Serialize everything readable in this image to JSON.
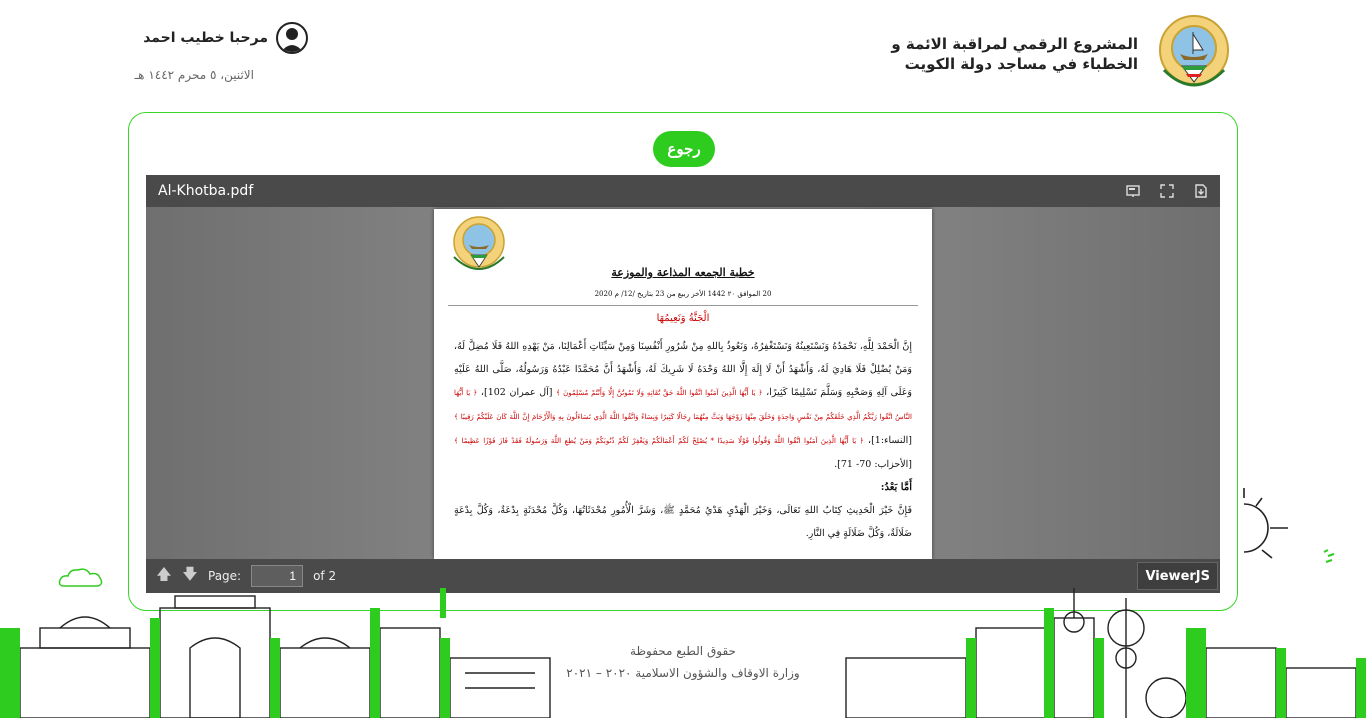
{
  "header": {
    "site_title_line1": "المشروع الرقمي لمراقبة الائمة و",
    "site_title_line2": "الخطباء في مساجد دولة الكويت",
    "greeting": "مرحبا خطيب احمد",
    "date": "الاثنين، ٥ محرم ١٤٤٢ هـ"
  },
  "main": {
    "back_label": "رجوع"
  },
  "viewer": {
    "file_name": "Al-Khotba.pdf",
    "page_label": "Page:",
    "page_value": "1",
    "page_total": "of 2",
    "brand": "ViewerJS",
    "icons": [
      "presentation-icon",
      "fullscreen-icon",
      "download-icon",
      "arrow-up-icon",
      "arrow-down-icon"
    ]
  },
  "pdf": {
    "title": "خطبة الجمعه المذاعة والموزعة",
    "subtitle": "20 الموافق ٢٠ 1442 الأخر ربيع من 23 بتاريخ /12/ م 2020",
    "heading": "الْجَنَّةُ وَنَعِيمُهَا",
    "p1": "إِنَّ الْحَمْدَ لِلَّهِ، نَحْمَدُهُ وَنَسْتَعِينُهُ وَنَسْتَغْفِرُهُ، وَنَعُوذُ بِاللهِ مِنْ شُرُورِ أَنْفُسِنَا وَمِنْ سَيِّئَاتِ أَعْمَالِنَا، مَنْ يَهْدِهِ اللهُ فَلَا مُضِلَّ لَهُ، وَمَنْ يُضْلِلْ فَلَا هَادِيَ لَهُ، وَأَشْهَدُ أَنْ لَا إِلَهَ إِلَّا اللهُ وَحْدَهُ لَا شَرِيكَ لَهُ، وَأَشْهَدُ أَنَّ مُحَمَّدًا عَبْدُهُ وَرَسُولُهُ، صَلَّى اللهُ عَلَيْهِ وَعَلَى آلِهِ وَصَحْبِهِ وَسَلَّمَ تَسْلِيمًا كَثِيرًا،",
    "q1": "﴿ يَا أَيُّهَا الَّذِينَ آمَنُوا اتَّقُوا اللَّهَ حَقَّ تُقَاتِهِ وَلَا تَمُوتُنَّ إِلَّا وَأَنْتُمْ مُسْلِمُونَ ﴾",
    "r1": "[آل عمران 102]،",
    "q2": "﴿ يَا أَيُّهَا النَّاسُ اتَّقُوا رَبَّكُمُ الَّذِي خَلَقَكُمْ مِنْ نَفْسٍ وَاحِدَةٍ وَخَلَقَ مِنْهَا زَوْجَهَا وَبَثَّ مِنْهُمَا رِجَالًا كَثِيرًا وَنِسَاءً وَاتَّقُوا اللَّهَ الَّذِي تَسَاءَلُونَ بِهِ وَالْأَرْحَامَ إِنَّ اللَّهَ كَانَ عَلَيْكُمْ رَقِيبًا ﴾",
    "r2": "[النساء:1]،",
    "q3": "﴿ يَا أَيُّهَا الَّذِينَ آمَنُوا اتَّقُوا اللَّهَ وَقُولُوا قَوْلًا سَدِيدًا * يُصْلِحْ لَكُمْ أَعْمَالَكُمْ وَيَغْفِرْ لَكُمْ ذُنُوبَكُمْ وَمَنْ يُطِعِ اللَّهَ وَرَسُولَهُ فَقَدْ فَازَ فَوْزًا عَظِيمًا ﴾",
    "r3": "[الأحزاب: 70- 71].",
    "amma": "أَمَّا بَعْدُ:",
    "p2": "فَإِنَّ خَيْرَ الْحَدِيثِ كِتَابُ اللهِ تَعَالَى، وَخَيْرَ الْهَدْيِ هَدْيُ مُحَمَّدٍ ﷺ، وَشَرَّ الْأُمُورِ مُحْدَثَاتُهَا، وَكُلَّ مُحْدَثَةٍ بِدْعَةٌ، وَكُلَّ بِدْعَةٍ ضَلَالَةٌ، وَكُلَّ ضَلَالَةٍ فِي النَّارِ."
  },
  "footer": {
    "copyright": "حقوق الطبع محفوظة",
    "ministry": "وزارة الاوقاف والشؤون الاسلامية ٢٠٢٠ – ٢٠٢١"
  },
  "colors": {
    "accent_green": "#2ecc1f",
    "card_border": "#39d629",
    "viewer_bar": "#4a4a4a",
    "quran_red": "#c00000"
  }
}
